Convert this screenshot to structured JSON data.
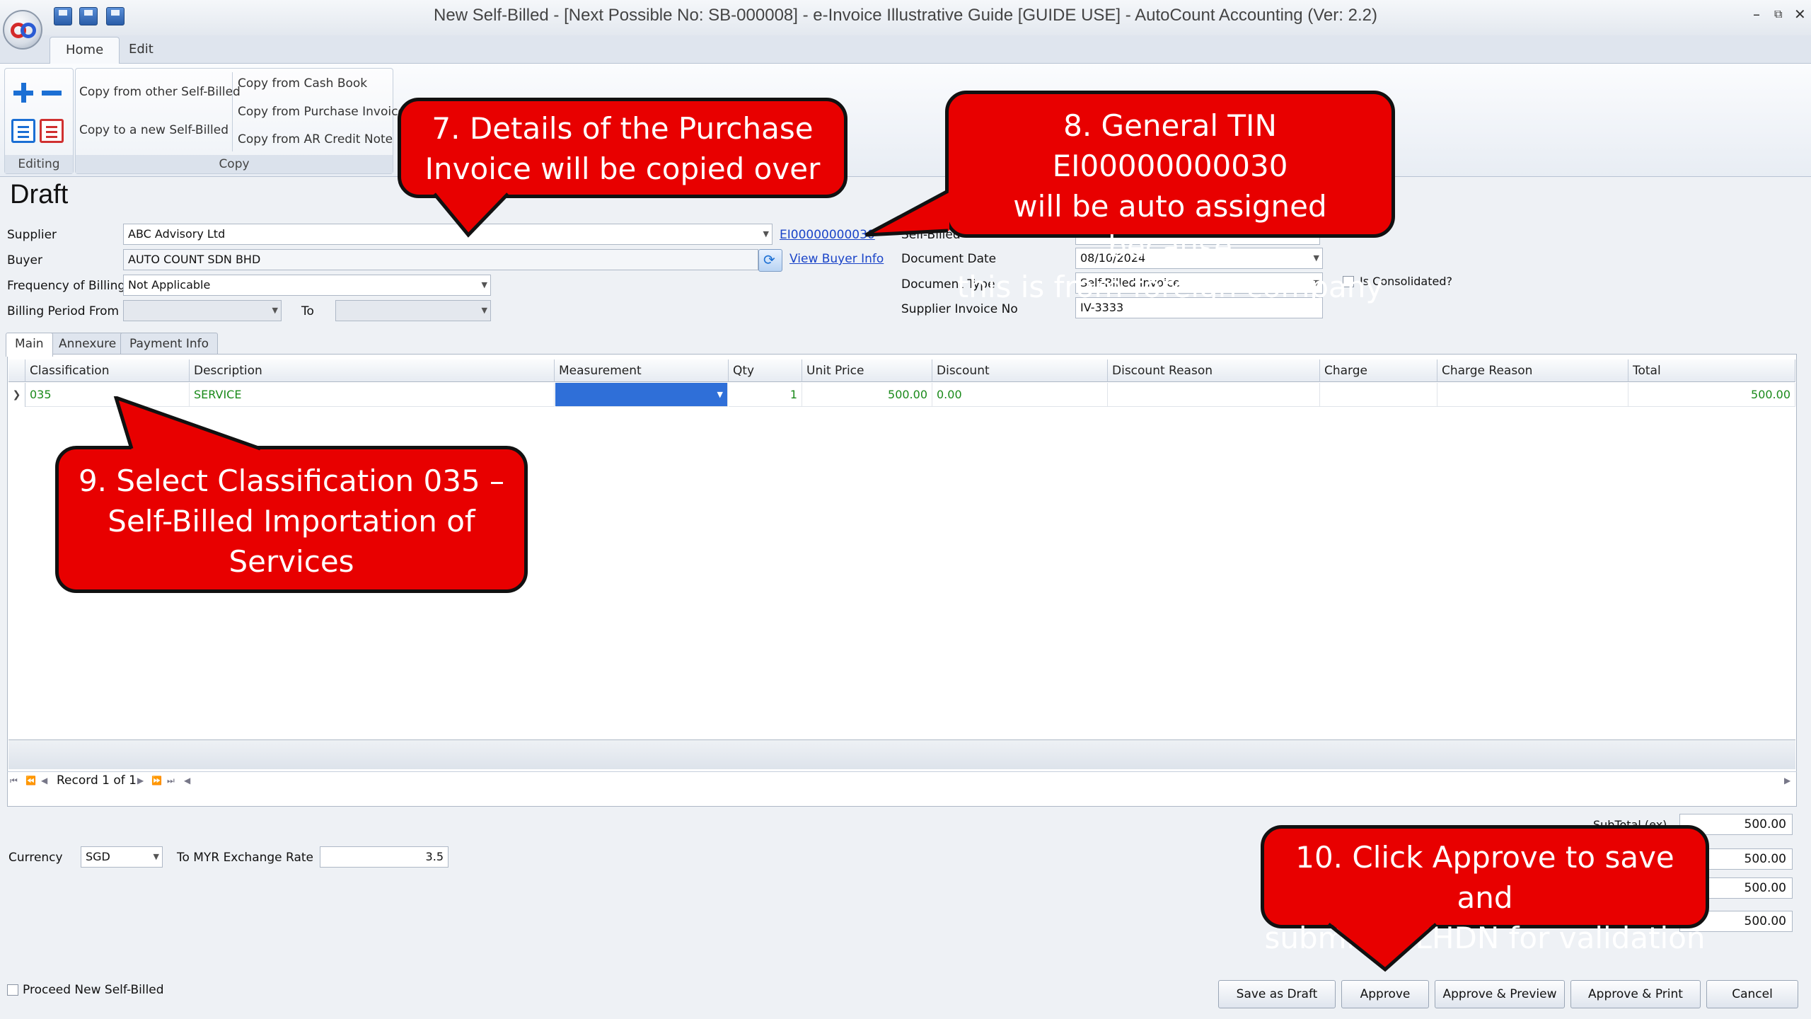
{
  "window": {
    "title": "New Self-Billed - [Next Possible No: SB-000008] - e-Invoice Illustrative Guide [GUIDE USE] - AutoCount Accounting (Ver: 2.2)"
  },
  "ribbon": {
    "tabs": [
      "Home",
      "Edit"
    ],
    "editing_label": "Editing",
    "copy_label": "Copy",
    "copy_other": "Copy from other Self-Billed",
    "copy_new": "Copy to a new Self-Billed",
    "copy_cash_book": "Copy from Cash Book",
    "copy_purchase_invoice": "Copy from Purchase Invoice",
    "copy_ar_credit_note": "Copy from AR Credit Note"
  },
  "form": {
    "status": "Draft",
    "supplier_label": "Supplier",
    "supplier_value": "ABC Advisory Ltd",
    "supplier_tin": "EI00000000030",
    "buyer_label": "Buyer",
    "buyer_value": "AUTO COUNT SDN BHD",
    "view_buyer_info": "View Buyer Info",
    "frequency_label": "Frequency of Billing",
    "frequency_value": "Not Applicable",
    "billing_period_label": "Billing Period From",
    "to_label": "To",
    "self_billed_label": "Self-Billed",
    "document_date_label": "Document Date",
    "document_date_value": "08/10/2024",
    "document_type_label": "Document Type",
    "document_type_value": "Self-Billed Invoice",
    "consolidated_label": "Is Consolidated?",
    "supplier_invoice_label": "Supplier Invoice No",
    "supplier_invoice_value": "IV-3333"
  },
  "tabs": [
    "Main",
    "Annexure",
    "Payment Info"
  ],
  "grid": {
    "columns": [
      "Classification",
      "Description",
      "Measurement",
      "Qty",
      "Unit Price",
      "Discount",
      "Discount Reason",
      "Charge",
      "Charge Reason",
      "Total"
    ],
    "rows": [
      {
        "classification": "035",
        "description": "SERVICE",
        "measurement": "",
        "qty": "1",
        "unit_price": "500.00",
        "discount": "0.00",
        "discount_reason": "",
        "charge": "",
        "charge_reason": "",
        "total": "500.00"
      }
    ],
    "record_text": "Record 1 of 1"
  },
  "bottom": {
    "currency_label": "Currency",
    "currency_value": "SGD",
    "exchange_label": "To MYR Exchange Rate",
    "exchange_value": "3.5",
    "subtotal_label": "SubTotal (ex)",
    "totals": [
      "500.00",
      "500.00",
      "500.00",
      "500.00"
    ],
    "proceed_label": "Proceed New Self-Billed"
  },
  "buttons": {
    "save_draft": "Save as Draft",
    "approve": "Approve",
    "approve_preview": "Approve & Preview",
    "approve_print": "Approve & Print",
    "cancel": "Cancel"
  },
  "callouts": {
    "c7": [
      "7. Details of the Purchase",
      "Invoice will be copied over"
    ],
    "c8": [
      "8. General TIN EI00000000030",
      "will be auto assigned because",
      "this is from foreign company"
    ],
    "c9": [
      "9. Select Classification 035 –",
      "Self-Billed Importation of",
      "Services"
    ],
    "c10": [
      "10. Click Approve to save and",
      "submit to LHDN for validation"
    ]
  },
  "colors": {
    "callout_fill": "#e80000",
    "selection_blue": "#2f6fd8",
    "grid_text_green": "#1a8a1a",
    "link_blue": "#1a44c8"
  }
}
